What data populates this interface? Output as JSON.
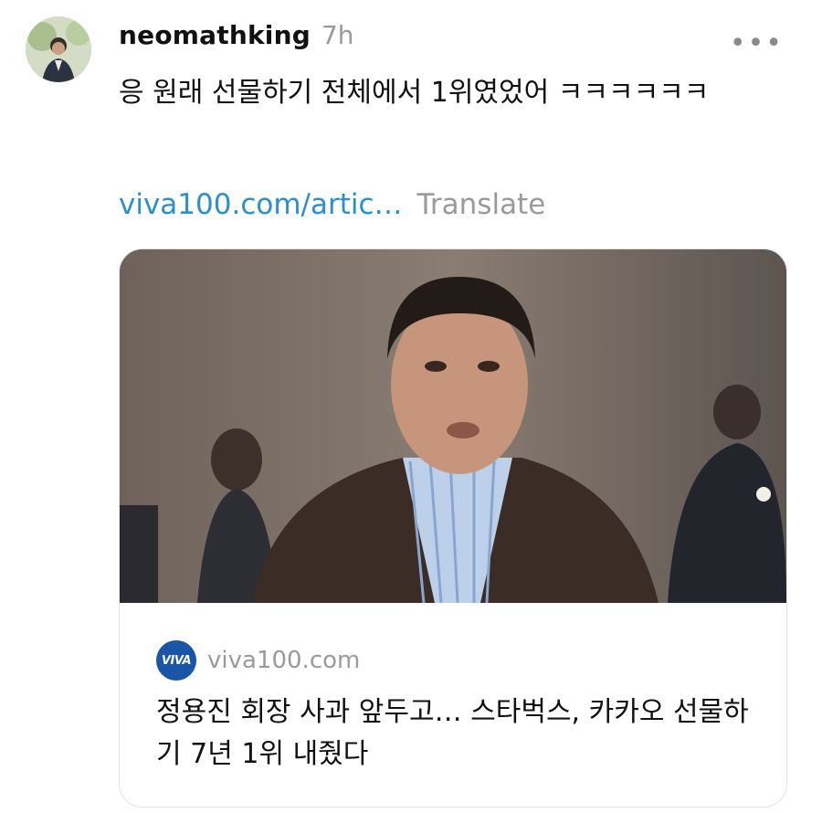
{
  "post": {
    "username": "neomathking",
    "time": "7h",
    "more_label": "•••",
    "text": "응 원래 선물하기 전체에서 1위였었어 ㅋㅋㅋㅋㅋㅋ",
    "link_text": "viva100.com/artic…",
    "translate_label": "Translate"
  },
  "card": {
    "logo_text": "VIVA",
    "domain": "viva100.com",
    "headline": "정용진 회장 사과 앞두고… 스타벅스, 카카오 선물하기 7년 1위 내줬다"
  },
  "colors": {
    "link": "#2a8fcf",
    "muted": "#9a9a9a",
    "logo_bg": "#1a56a8"
  }
}
